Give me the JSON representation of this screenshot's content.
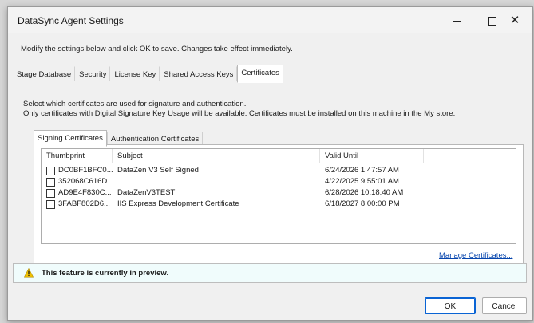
{
  "window": {
    "title": "DataSync Agent Settings",
    "controls": {
      "minimize": "minimize",
      "maximize": "maximize",
      "close": "✕"
    }
  },
  "intro": "Modify the settings below and click OK to save. Changes take effect immediately.",
  "tabs": [
    {
      "label": "Stage Database",
      "active": false
    },
    {
      "label": "Security",
      "active": false
    },
    {
      "label": "License Key",
      "active": false
    },
    {
      "label": "Shared Access Keys",
      "active": false
    },
    {
      "label": "Certificates",
      "active": true
    }
  ],
  "certificates": {
    "description_line1": "Select which certificates are used for signature and authentication.",
    "description_line2": "Only certificates with Digital Signature Key Usage will be available. Certificates must be installed on this machine in the My store.",
    "subtabs": [
      {
        "label": "Signing Certificates",
        "active": true
      },
      {
        "label": "Authentication Certificates",
        "active": false
      }
    ],
    "columns": {
      "thumbprint": "Thumbprint",
      "subject": "Subject",
      "valid_until": "Valid Until"
    },
    "rows": [
      {
        "checked": false,
        "thumbprint": "DC0BF1BFC0...",
        "subject": "DataZen V3 Self Signed",
        "valid_until": "6/24/2026 1:47:57 AM"
      },
      {
        "checked": false,
        "thumbprint": "352068C616D...",
        "subject": "",
        "valid_until": "4/22/2025 9:55:01 AM"
      },
      {
        "checked": false,
        "thumbprint": "AD9E4F830C...",
        "subject": "DataZenV3TEST",
        "valid_until": "6/28/2026 10:18:40 AM"
      },
      {
        "checked": false,
        "thumbprint": "3FABF802D6...",
        "subject": "IIS Express Development Certificate",
        "valid_until": "6/18/2027 8:00:00 PM"
      }
    ],
    "manage_link": "Manage Certificates..."
  },
  "preview_notice": {
    "icon": "warning-icon",
    "text": "This feature is currently in preview.",
    "icon_color": "#f2c200"
  },
  "buttons": {
    "ok": "OK",
    "cancel": "Cancel"
  },
  "colors": {
    "link": "#0645ad",
    "default_button_border": "#0a64d4",
    "preview_background": "#f0fcfc"
  }
}
